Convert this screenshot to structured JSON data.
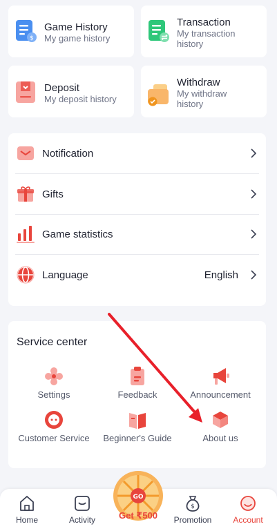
{
  "history": {
    "game_history": {
      "title": "Game History",
      "sub": "My game history"
    },
    "transaction": {
      "title": "Transaction",
      "sub_line1": "My transaction",
      "sub_line2": "history"
    },
    "deposit": {
      "title": "Deposit",
      "sub": "My deposit history"
    },
    "withdraw": {
      "title": "Withdraw",
      "sub_line1": "My withdraw",
      "sub_line2": "history"
    }
  },
  "menu": {
    "notification": "Notification",
    "gifts": "Gifts",
    "game_statistics": "Game statistics",
    "language": "Language",
    "language_value": "English"
  },
  "service": {
    "title": "Service center",
    "items": [
      {
        "label": "Settings",
        "icon": "settings-icon"
      },
      {
        "label": "Feedback",
        "icon": "feedback-icon"
      },
      {
        "label": "Announcement",
        "icon": "megaphone-icon"
      },
      {
        "label": "Customer Service",
        "icon": "customer-service-icon"
      },
      {
        "label": "Beginner's Guide",
        "icon": "book-icon"
      },
      {
        "label": "About us",
        "icon": "cube-icon"
      }
    ]
  },
  "tabbar": {
    "home": "Home",
    "activity": "Activity",
    "get_bonus": "Get ₹500",
    "promotion": "Promotion",
    "account": "Account"
  },
  "colors": {
    "accent": "#e8453c",
    "icon_pink": "#f7a5a0",
    "blue": "#4a8ff0",
    "green": "#2ec77a"
  }
}
